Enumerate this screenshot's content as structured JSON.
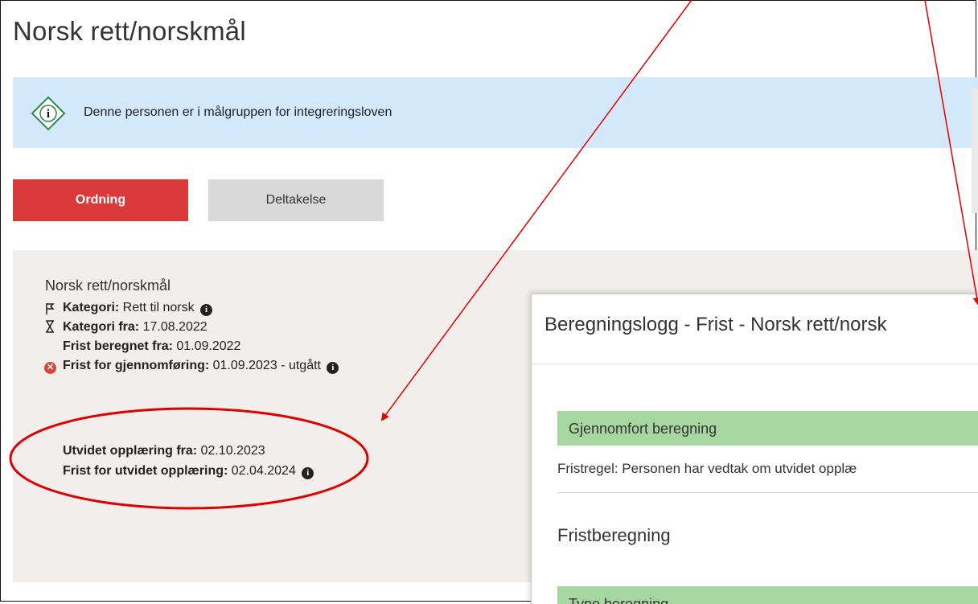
{
  "page": {
    "title": "Norsk rett/norskmål"
  },
  "banner": {
    "text": "Denne personen er i målgruppen for integreringsloven",
    "icon": "info-diamond-icon"
  },
  "tabs": [
    {
      "label": "Ordning",
      "active": true
    },
    {
      "label": "Deltakelse",
      "active": false
    }
  ],
  "panel": {
    "title": "Norsk rett/norskmål",
    "rows": [
      {
        "label": "Kategori:",
        "value": " Rett til norsk",
        "icon": "flag-icon",
        "info": true
      },
      {
        "label": "Kategori fra:",
        "value": " 17.08.2022",
        "icon": "hourglass-icon",
        "info": false
      },
      {
        "label": "Frist beregnet fra:",
        "value": " 01.09.2022",
        "icon": "",
        "info": false
      },
      {
        "label": "Frist for gjennomføring:",
        "value": " 01.09.2023 - utgått",
        "icon": "error-circle-icon",
        "info": true
      },
      {
        "label": "Utvidet opplæring fra:",
        "value": " 02.10.2023",
        "icon": "",
        "info": false
      },
      {
        "label": "Frist for utvidet opplæring:",
        "value": " 02.04.2024",
        "icon": "",
        "info": true
      }
    ]
  },
  "modal": {
    "title": "Beregningslogg - Frist - Norsk rett/norsk",
    "computed_header": "Gjennomfort beregning",
    "rule_text": "Fristregel: Personen har vedtak om utvidet opplæ",
    "section_title": "Fristberegning",
    "type_header": "Type beregning"
  },
  "colors": {
    "accent_red": "#db3a3a",
    "banner_blue": "#d3e8fb",
    "panel_beige": "#f1eeeb",
    "modal_green": "#a7d7a0",
    "annotation_red": "#e00000"
  }
}
